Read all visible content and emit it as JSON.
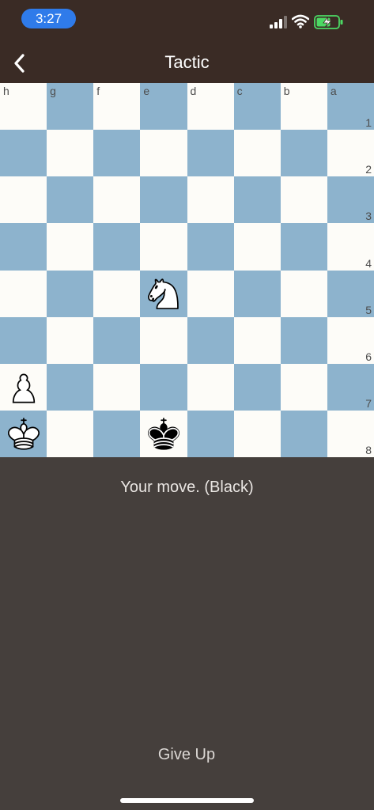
{
  "status_bar": {
    "time": "3:27",
    "time_pill_color": "#2f7bea",
    "battery_color": "#4cd964"
  },
  "header": {
    "title": "Tactic",
    "back_icon": "chevron-left-icon"
  },
  "board": {
    "light_color": "#fdfcf8",
    "dark_color": "#8db3cd",
    "files": [
      "h",
      "g",
      "f",
      "e",
      "d",
      "c",
      "b",
      "a"
    ],
    "ranks": [
      "1",
      "2",
      "3",
      "4",
      "5",
      "6",
      "7",
      "8"
    ],
    "pieces": [
      {
        "square": "e5",
        "piece": "white-knight"
      },
      {
        "square": "h7",
        "piece": "white-pawn"
      },
      {
        "square": "h8",
        "piece": "white-king"
      },
      {
        "square": "e8",
        "piece": "black-king"
      }
    ]
  },
  "game_status": "Your move. (Black)",
  "actions": {
    "give_up_label": "Give Up"
  }
}
